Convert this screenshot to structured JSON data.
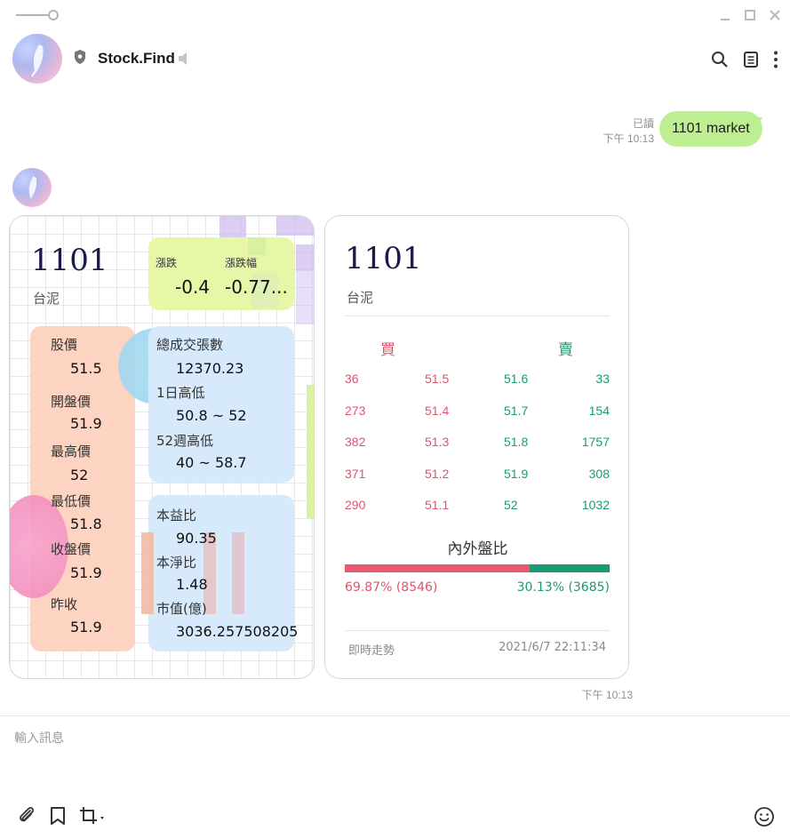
{
  "header": {
    "chat_name": "Stock.Find"
  },
  "message": {
    "text": "1101 market",
    "read_status": "已讀",
    "time": "下午 10:13"
  },
  "reply_time": "下午 10:13",
  "summary_card": {
    "code": "1101",
    "name": "台泥",
    "change_label": "漲跌",
    "change_value": "-0.4",
    "change_pct_label": "漲跌幅",
    "change_pct_value": "-0.77...",
    "prices": [
      {
        "label": "股價",
        "value": "51.5"
      },
      {
        "label": "開盤價",
        "value": "51.9"
      },
      {
        "label": "最高價",
        "value": "52"
      },
      {
        "label": "最低價",
        "value": "51.8"
      },
      {
        "label": "收盤價",
        "value": "51.9"
      },
      {
        "label": "昨收",
        "value": "51.9"
      }
    ],
    "volume": [
      {
        "label": "總成交張數",
        "value": "12370.23"
      },
      {
        "label": "1日高低",
        "value": "50.8 ~ 52"
      },
      {
        "label": "52週高低",
        "value": "40 ~ 58.7"
      }
    ],
    "ratios": [
      {
        "label": "本益比",
        "value": "90.35"
      },
      {
        "label": "本淨比",
        "value": "1.48"
      },
      {
        "label": "市值(億)",
        "value": "3036.257508205"
      }
    ]
  },
  "orderbook_card": {
    "code": "1101",
    "name": "台泥",
    "buy_label": "買",
    "sell_label": "賣",
    "rows": [
      {
        "bid_qty": "36",
        "bid": "51.5",
        "ask": "51.6",
        "ask_qty": "33"
      },
      {
        "bid_qty": "273",
        "bid": "51.4",
        "ask": "51.7",
        "ask_qty": "154"
      },
      {
        "bid_qty": "382",
        "bid": "51.3",
        "ask": "51.8",
        "ask_qty": "1757"
      },
      {
        "bid_qty": "371",
        "bid": "51.2",
        "ask": "51.9",
        "ask_qty": "308"
      },
      {
        "bid_qty": "290",
        "bid": "51.1",
        "ask": "52",
        "ask_qty": "1032"
      }
    ],
    "ratio_title": "內外盤比",
    "inner_ratio_text": "69.87% (8546)",
    "outer_ratio_text": "30.13% (3685)",
    "inner_ratio": 0.6987,
    "footer_link": "即時走勢",
    "footer_time": "2021/6/7 22:11:34"
  },
  "input": {
    "placeholder": "輸入訊息"
  },
  "colors": {
    "bubble": "#bdee91",
    "buy_red": "#e8586e",
    "sell_green": "#1a9a74"
  }
}
